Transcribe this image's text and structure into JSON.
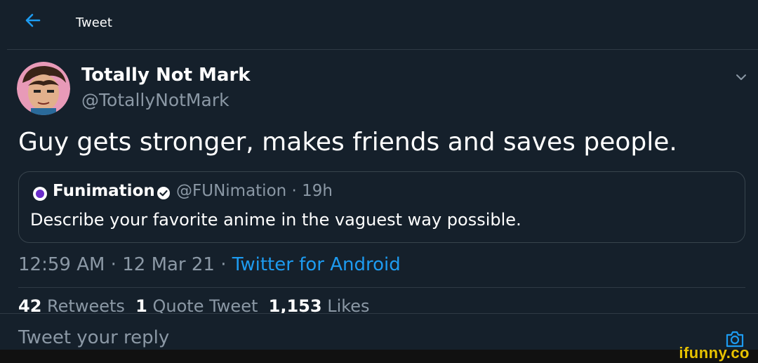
{
  "header": {
    "title": "Tweet",
    "back_icon": "arrow-left-icon"
  },
  "tweet": {
    "display_name": "Totally Not Mark",
    "handle": "@TotallyNotMark",
    "text": "Guy gets stronger, makes friends and saves people.",
    "time": "12:59 AM",
    "date": "12 Mar 21",
    "source": "Twitter for Android",
    "separator": " · "
  },
  "quote": {
    "display_name": "Funimation",
    "handle": "@FUNimation",
    "age": "19h",
    "text": "Describe your favorite anime in the vaguest way possible."
  },
  "stats": {
    "retweets_count": "42",
    "retweets_label": "Retweets",
    "quotes_count": "1",
    "quotes_label": "Quote Tweet",
    "likes_count": "1,153",
    "likes_label": "Likes"
  },
  "reply": {
    "placeholder": "Tweet your reply"
  },
  "watermark": "ifunny.co",
  "colors": {
    "background": "#15202b",
    "accent": "#1d9bf0",
    "secondary_text": "#8b98a5",
    "border": "#38444d"
  }
}
